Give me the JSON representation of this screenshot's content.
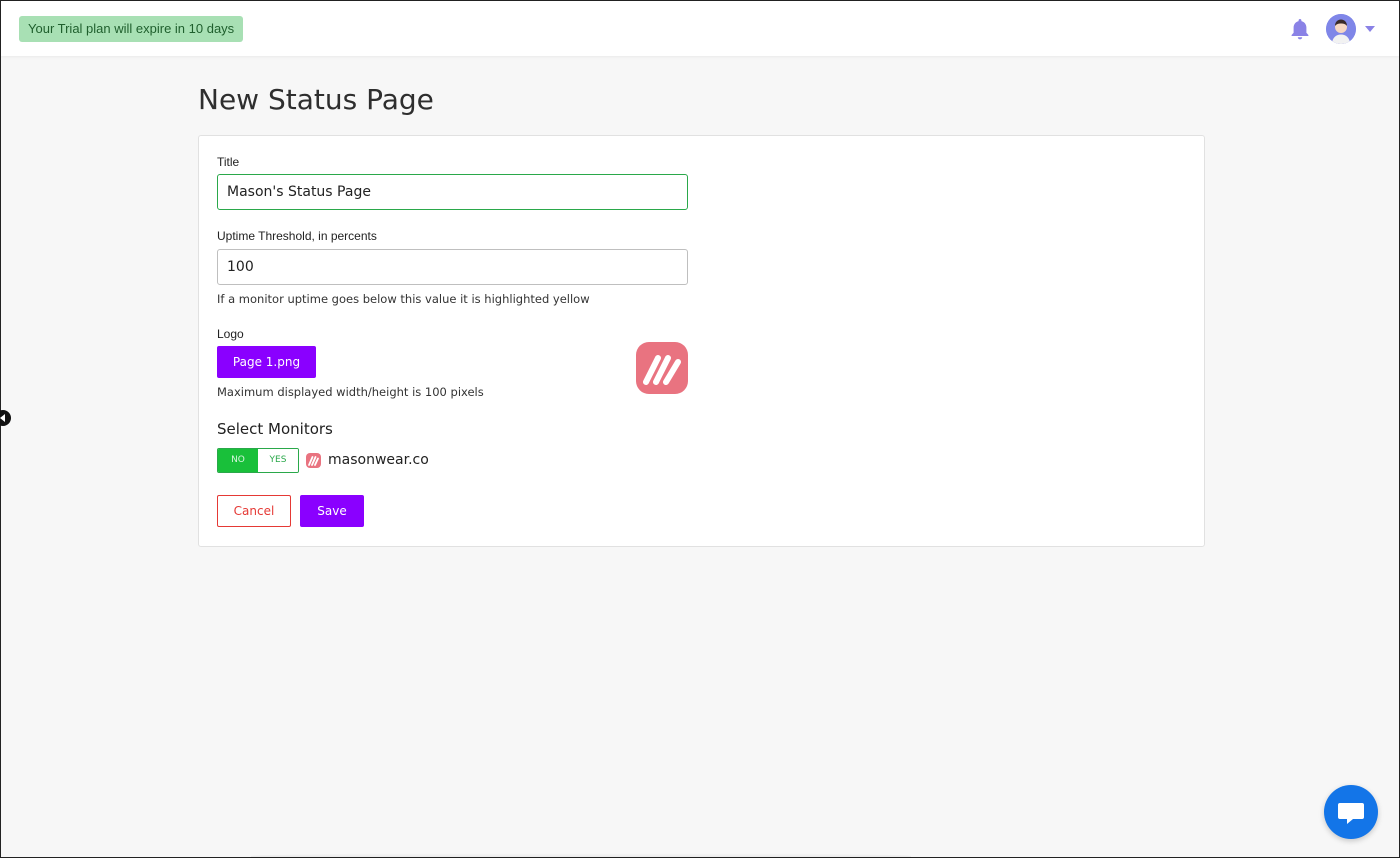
{
  "topbar": {
    "trial_notice": "Your Trial plan will expire in 10 days",
    "notification_icon": "bell-icon",
    "avatar_icon": "user-avatar",
    "menu_caret_icon": "caret-down-icon",
    "accent_color": "#8a82e6"
  },
  "page": {
    "title": "New Status Page"
  },
  "form": {
    "title_label": "Title",
    "title_value": "Mason's Status Page",
    "threshold_label": "Uptime Threshold, in percents",
    "threshold_value": "100",
    "threshold_help": "If a monitor uptime goes below this value it is highlighted yellow",
    "logo_label": "Logo",
    "logo_button": "Page 1.png",
    "logo_help": "Maximum displayed width/height is 100 pixels",
    "monitors_title": "Select Monitors",
    "monitors": [
      {
        "toggle_no": "NO",
        "toggle_yes": "YES",
        "selected": "NO",
        "name": "masonwear.co"
      }
    ],
    "cancel_label": "Cancel",
    "save_label": "Save"
  },
  "colors": {
    "primary": "#8a00ff",
    "danger": "#e53935",
    "success": "#19c03a",
    "logo_bg": "#e97380",
    "chat_button": "#1375e8"
  },
  "icons": {
    "sidebar_toggle": "chevron-left-icon",
    "chat": "chat-bubble-icon"
  }
}
